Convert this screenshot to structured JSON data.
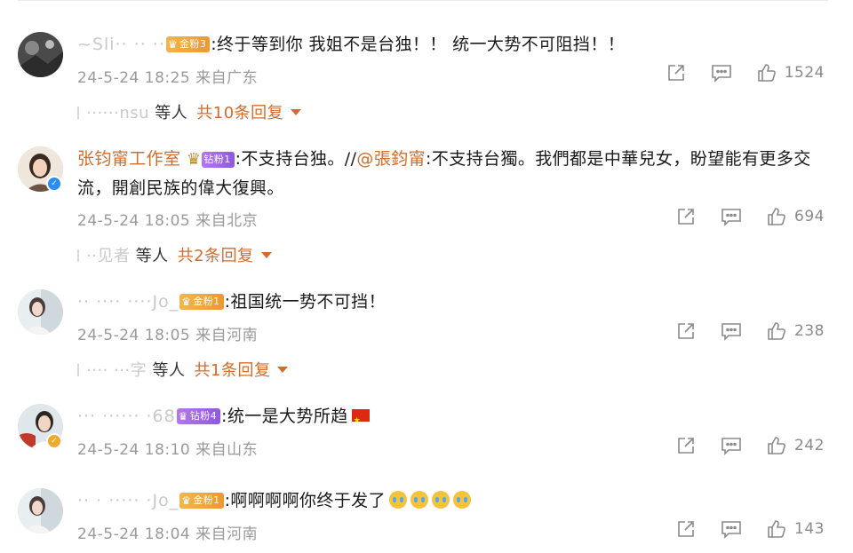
{
  "comments": [
    {
      "username": "~Sli·· ·· ··",
      "fan_badge": {
        "label": "金粉3",
        "kind": "gold"
      },
      "text": ":终于等到你 我姐不是台独！！ 统一大势不可阻挡！！",
      "time": "24-5-24 18:25",
      "location": "来自广东",
      "likes": "1524",
      "replies": {
        "who": "······nsu",
        "suffix": "等人",
        "count": "共10条回复"
      }
    },
    {
      "username": "张钧甯工作室",
      "fan_badge": {
        "label": "钻粉1",
        "kind": "diamond"
      },
      "text_prefix": ":不支持台独。//",
      "mention": "@張鈞甯",
      "text_suffix": ":不支持台獨。我們都是中華兒女，盼望能有更多交流，開創民族的偉大復興。",
      "time": "24-5-24 18:05",
      "location": "来自北京",
      "likes": "694",
      "replies": {
        "who": "··见者",
        "suffix": "等人",
        "count": "共2条回复"
      }
    },
    {
      "username": "·· ···· ····Jo_",
      "fan_badge": {
        "label": "金粉1",
        "kind": "gold"
      },
      "text": ":祖国统一势不可挡！",
      "time": "24-5-24 18:05",
      "location": "来自河南",
      "likes": "238",
      "replies": {
        "who": "···· ···字",
        "suffix": "等人",
        "count": "共1条回复"
      }
    },
    {
      "username": "··· ······ ·68",
      "fan_badge": {
        "label": "钻粉4",
        "kind": "diamond"
      },
      "text": ":统一是大势所趋",
      "time": "24-5-24 18:10",
      "location": "来自山东",
      "likes": "242"
    },
    {
      "username": "·· · ····· ·Jo_",
      "fan_badge": {
        "label": "金粉1",
        "kind": "gold"
      },
      "text": ":啊啊啊啊你终于发了",
      "time": "24-5-24 18:04",
      "location": "来自河南",
      "likes": "143"
    }
  ],
  "icons": {
    "share": "share-icon",
    "comment": "comment-icon",
    "like": "like-icon",
    "verified": "verified-icon",
    "crown": "crown-icon"
  },
  "colors": {
    "accent": "#d26c2b",
    "meta": "#9a9a9a",
    "gold_badge": "#f2b64b",
    "diamond_badge": "#a16ae8",
    "verified_blue": "#2d8cf0",
    "verified_gold": "#f0a92b"
  }
}
